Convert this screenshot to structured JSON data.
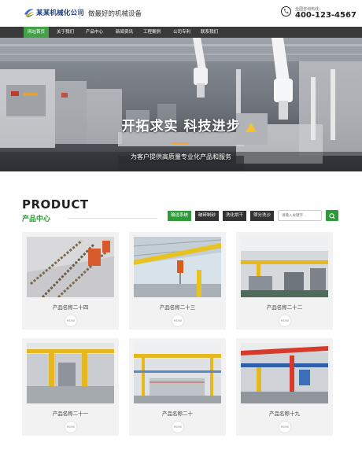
{
  "header": {
    "logo_text": "某某机械化公司",
    "slogan": "做最好的机械设备",
    "hotline_label": "全国咨询热线：",
    "hotline_number": "400-123-4567"
  },
  "nav": {
    "items": [
      {
        "label": "网站首页",
        "active": true
      },
      {
        "label": "关于我们",
        "active": false
      },
      {
        "label": "产品中心",
        "active": false
      },
      {
        "label": "新闻资讯",
        "active": false
      },
      {
        "label": "工程案例",
        "active": false
      },
      {
        "label": "公司专利",
        "active": false
      },
      {
        "label": "联系我们",
        "active": false
      }
    ]
  },
  "banner": {
    "title": "开拓求实 科技进步",
    "subtitle": "为客户提供高质量专业化产品和服务"
  },
  "products_section": {
    "title_en": "PRODUCT",
    "title_cn": "产品中心",
    "categories": [
      "输送系统",
      "破碎制砂",
      "洗化烘干",
      "筛分洗沙"
    ],
    "search_placeholder": "请输入关键字...",
    "more_label": "MORE",
    "items": [
      {
        "name": "产品名称二十四"
      },
      {
        "name": "产品名称二十三"
      },
      {
        "name": "产品名称二十二"
      },
      {
        "name": "产品名称二十一"
      },
      {
        "name": "产品名称二十"
      },
      {
        "name": "产品名称十九"
      }
    ]
  },
  "colors": {
    "accent_green": "#2e9a3a",
    "nav_bg": "#3a3a3a",
    "banner_rule": "#f2a33a"
  }
}
